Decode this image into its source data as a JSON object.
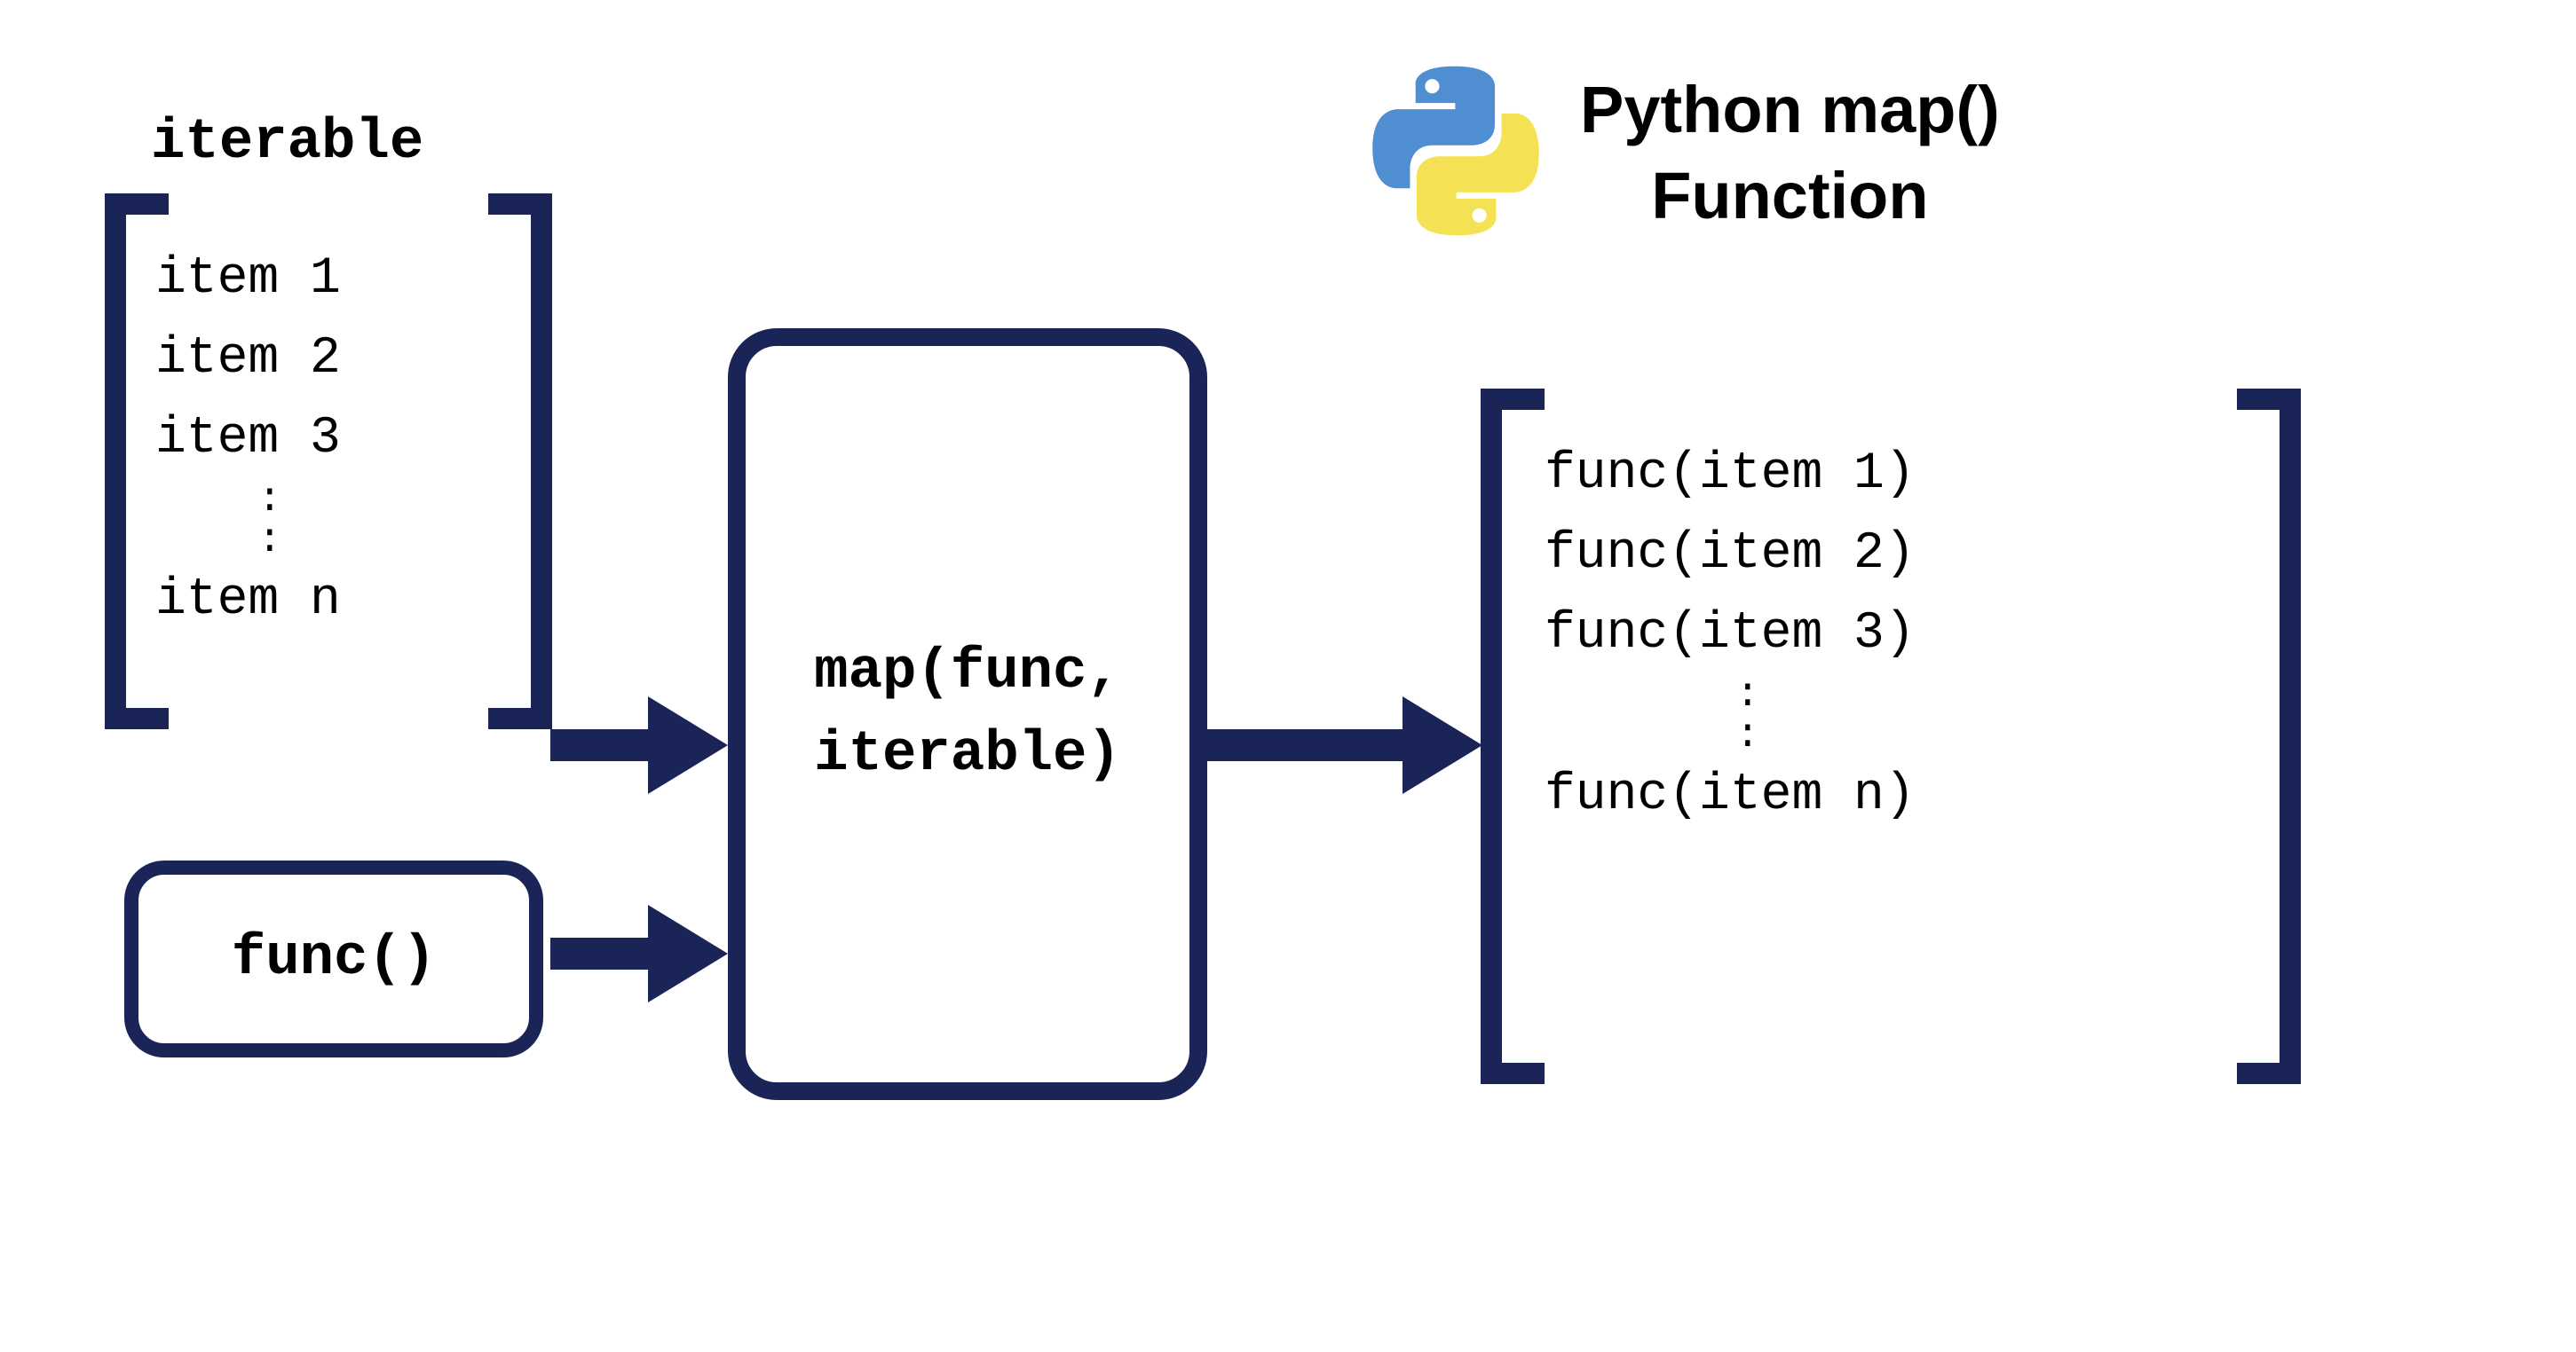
{
  "title": {
    "line1": "Python map()",
    "line2": "Function"
  },
  "iterable": {
    "label": "iterable",
    "items": [
      "item 1",
      "item 2",
      "item 3"
    ],
    "last_item": "item n"
  },
  "func_box": {
    "label": "func()"
  },
  "map_box": {
    "line1": "map(func,",
    "line2": "iterable)"
  },
  "result": {
    "items": [
      "func(item 1)",
      "func(item 2)",
      "func(item 3)"
    ],
    "last_item": "func(item n)"
  },
  "colors": {
    "navy": "#1a2457",
    "python_blue": "#4f8ed1",
    "python_yellow": "#f5e254"
  }
}
